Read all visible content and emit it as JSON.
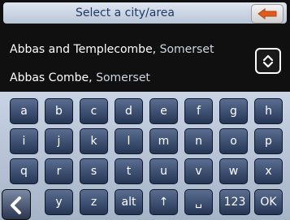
{
  "header": {
    "title": "Select a city/area",
    "back_icon": "back-arrow-icon",
    "accent_color": "#e05a1e"
  },
  "list": {
    "items": [
      {
        "name": "Abbas and Templecombe,",
        "region": "Somerset"
      },
      {
        "name": "Abbas Combe,",
        "region": "Somerset"
      }
    ],
    "scroll_icon": "scroll-updown-icon"
  },
  "keyboard": {
    "rows": [
      [
        "a",
        "b",
        "c",
        "d",
        "e",
        "f",
        "g",
        "h"
      ],
      [
        "i",
        "j",
        "k",
        "l",
        "m",
        "n",
        "o",
        "p"
      ],
      [
        "q",
        "r",
        "s",
        "t",
        "u",
        "v",
        "w",
        "x"
      ],
      [
        "y",
        "z",
        "alt",
        "↑",
        "␣",
        "123",
        "OK"
      ]
    ],
    "left_icon": "chevron-left-icon"
  }
}
